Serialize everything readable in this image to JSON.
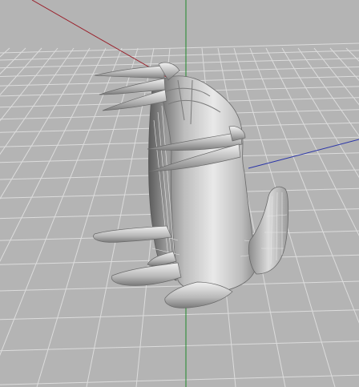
{
  "viewport": {
    "background_color": "#b4b4b4",
    "grid": {
      "visible": true,
      "line_color": "#dcdcdc"
    },
    "axes": {
      "x_axis_color": "#9a1f2a",
      "y_axis_color": "#1f8a2a",
      "z_axis_color": "#2a35a8"
    },
    "model": {
      "description_icon": "sculpted-creature-mesh-icon",
      "material_color": "#a9a9a9",
      "wireframe_color": "#e6e6e6"
    }
  }
}
